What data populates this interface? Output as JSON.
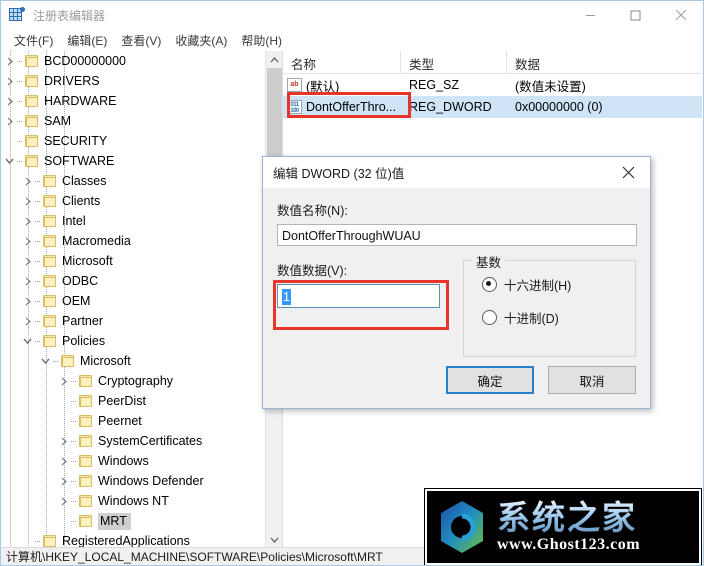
{
  "window": {
    "title": "注册表编辑器",
    "app_icon": "registry-editor-icon",
    "controls": {
      "minimize": "minimize-icon",
      "maximize": "maximize-icon",
      "close": "close-icon"
    }
  },
  "menubar": {
    "items": [
      {
        "label": "文件(F)"
      },
      {
        "label": "编辑(E)"
      },
      {
        "label": "查看(V)"
      },
      {
        "label": "收藏夹(A)"
      },
      {
        "label": "帮助(H)"
      }
    ]
  },
  "tree": {
    "nodes": [
      {
        "label": "BCD00000000",
        "indent": 1,
        "twisty": "collapsed",
        "selected": false
      },
      {
        "label": "DRIVERS",
        "indent": 1,
        "twisty": "collapsed",
        "selected": false
      },
      {
        "label": "HARDWARE",
        "indent": 1,
        "twisty": "collapsed",
        "selected": false
      },
      {
        "label": "SAM",
        "indent": 1,
        "twisty": "collapsed",
        "selected": false
      },
      {
        "label": "SECURITY",
        "indent": 1,
        "twisty": "none",
        "selected": false
      },
      {
        "label": "SOFTWARE",
        "indent": 1,
        "twisty": "expanded",
        "selected": false
      },
      {
        "label": "Classes",
        "indent": 2,
        "twisty": "collapsed",
        "selected": false
      },
      {
        "label": "Clients",
        "indent": 2,
        "twisty": "collapsed",
        "selected": false
      },
      {
        "label": "Intel",
        "indent": 2,
        "twisty": "collapsed",
        "selected": false
      },
      {
        "label": "Macromedia",
        "indent": 2,
        "twisty": "collapsed",
        "selected": false
      },
      {
        "label": "Microsoft",
        "indent": 2,
        "twisty": "collapsed",
        "selected": false
      },
      {
        "label": "ODBC",
        "indent": 2,
        "twisty": "collapsed",
        "selected": false
      },
      {
        "label": "OEM",
        "indent": 2,
        "twisty": "collapsed",
        "selected": false
      },
      {
        "label": "Partner",
        "indent": 2,
        "twisty": "collapsed",
        "selected": false
      },
      {
        "label": "Policies",
        "indent": 2,
        "twisty": "expanded",
        "selected": false
      },
      {
        "label": "Microsoft",
        "indent": 3,
        "twisty": "expanded",
        "selected": false
      },
      {
        "label": "Cryptography",
        "indent": 4,
        "twisty": "collapsed",
        "selected": false
      },
      {
        "label": "PeerDist",
        "indent": 4,
        "twisty": "none",
        "selected": false
      },
      {
        "label": "Peernet",
        "indent": 4,
        "twisty": "none",
        "selected": false
      },
      {
        "label": "SystemCertificates",
        "indent": 4,
        "twisty": "collapsed",
        "selected": false
      },
      {
        "label": "Windows",
        "indent": 4,
        "twisty": "collapsed",
        "selected": false
      },
      {
        "label": "Windows Defender",
        "indent": 4,
        "twisty": "collapsed",
        "selected": false
      },
      {
        "label": "Windows NT",
        "indent": 4,
        "twisty": "collapsed",
        "selected": false
      },
      {
        "label": "MRT",
        "indent": 4,
        "twisty": "none",
        "selected": true
      },
      {
        "label": "RegisteredApplications",
        "indent": 2,
        "twisty": "none",
        "selected": false
      }
    ],
    "scrollbar": {
      "up_arrow": "chevron-up-icon",
      "down_arrow": "chevron-down-icon"
    }
  },
  "list": {
    "columns": [
      "名称",
      "类型",
      "数据"
    ],
    "rows": [
      {
        "icon": "string-value-icon",
        "name": "(默认)",
        "type": "REG_SZ",
        "data": "(数值未设置)",
        "highlight": false
      },
      {
        "icon": "dword-value-icon",
        "name": "DontOfferThro...",
        "type": "REG_DWORD",
        "data": "0x00000000 (0)",
        "highlight": true
      }
    ]
  },
  "statusbar": {
    "path": "计算机\\HKEY_LOCAL_MACHINE\\SOFTWARE\\Policies\\Microsoft\\MRT"
  },
  "dialog": {
    "title": "编辑 DWORD (32 位)值",
    "close_icon": "close-icon",
    "value_name_label": "数值名称(N):",
    "value_name": "DontOfferThroughWUAU",
    "value_data_label": "数值数据(V):",
    "value_data": "1",
    "base_group_label": "基数",
    "radios": [
      {
        "label": "十六进制(H)",
        "checked": true
      },
      {
        "label": "十进制(D)",
        "checked": false
      }
    ],
    "ok_label": "确定",
    "cancel_label": "取消"
  },
  "watermark": {
    "cn_text": "系统之家",
    "url_text": "www.Ghost123.com"
  },
  "colors": {
    "accent": "#2a7fc9",
    "highlight_red": "#e8352a",
    "selection_blue": "#3399ff",
    "row_highlight": "#cfe4f7"
  }
}
